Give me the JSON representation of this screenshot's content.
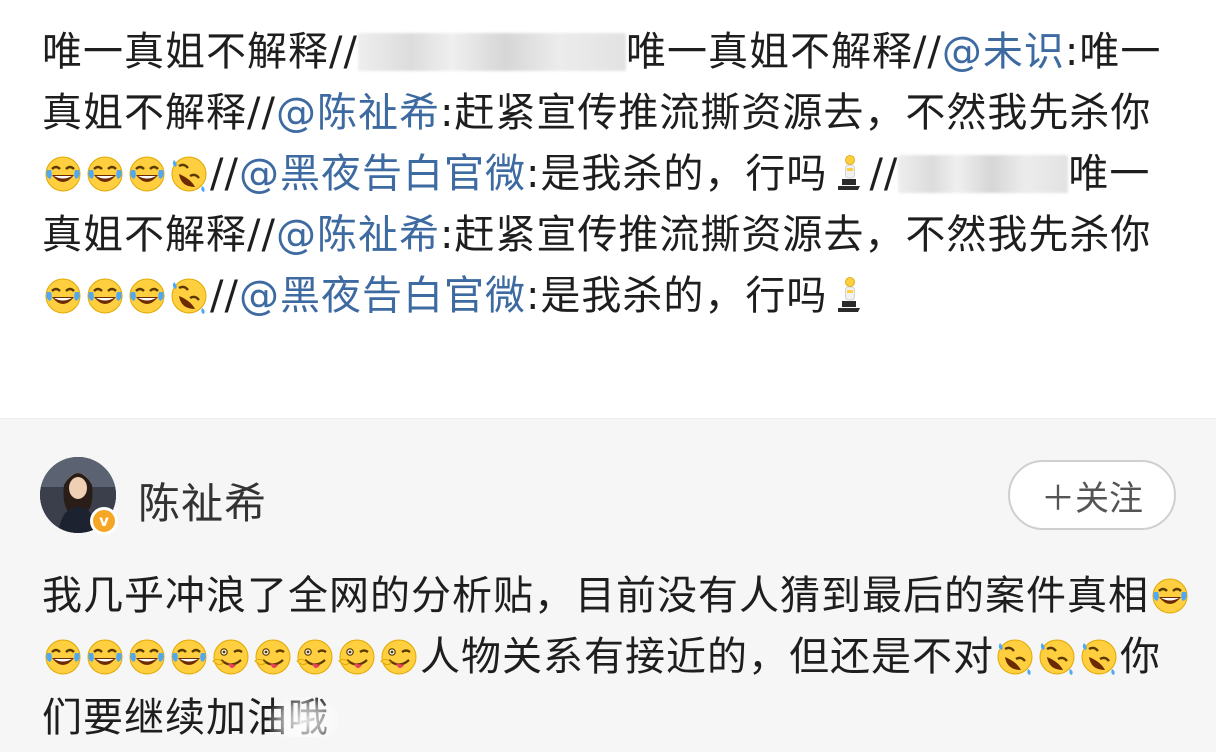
{
  "repost": {
    "seg1": "唯一真姐不解释//",
    "seg2": "唯一真姐不解释//",
    "mention1": "@未识",
    "seg3": ":唯一真姐不解释//",
    "mention2": "@陈祉希",
    "seg4": ":赶紧宣传推流撕资源去，不然我先杀你",
    "seg5": "//",
    "mention3": "@黑夜告白官微",
    "seg6": ":是我杀的，行吗",
    "seg7": "//",
    "seg8": "唯一真姐不解释//",
    "mention4": "@陈祉希",
    "seg9": ":赶紧宣传推流撕资源去，不然我先杀你",
    "seg10": "//",
    "mention5": "@黑夜告白官微",
    "seg11": ":是我杀的，行吗"
  },
  "card": {
    "username": "陈祉希",
    "verified_badge": "v",
    "follow_label": "＋关注",
    "text1": "我几乎冲浪了全网的分析贴，目前没有人猜到最后的案件真相",
    "text2": "人物关系有接近的，但还是不对",
    "text3": "你们要继续加油哦"
  },
  "icons": {
    "laugh_cry": "face-with-tears-of-joy-icon",
    "rofl": "rolling-on-floor-laughing-icon",
    "tongue": "zany-face-icon",
    "kneel": "kneeling-person-icon"
  },
  "colors": {
    "mention": "#3d6aa1",
    "text": "#1e1e1e",
    "card_bg": "#f6f6f6",
    "emoji_yellow": "#ffcf3f"
  }
}
